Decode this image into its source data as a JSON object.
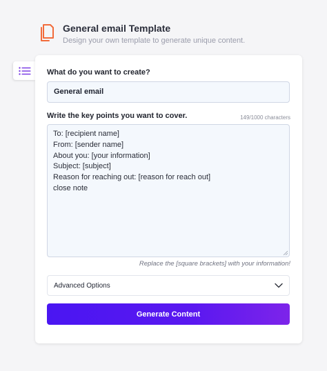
{
  "header": {
    "icon": "copy-document-icon",
    "title": "General email Template",
    "subtitle": "Design your own template to generate unique content."
  },
  "sidebar_toggle": {
    "icon": "list-menu-icon"
  },
  "form": {
    "create_label": "What do you want to create?",
    "create_value": "General email",
    "points_label": "Write the key points you want to cover.",
    "points_counter": "149/1000 characters",
    "points_lines": [
      "To: [recipient name]",
      "From: [sender name]",
      "About you: [your information]",
      "Subject: [subject]",
      "Reason for reaching out: [reason for reach out]",
      "close note"
    ],
    "hint": "Replace the [square brackets] with your information!",
    "advanced_label": "Advanced Options",
    "generate_label": "Generate Content"
  },
  "colors": {
    "accent": "#f26b3a",
    "button_start": "#4a16f2",
    "button_end": "#7d24ea",
    "menu_icon": "#7b3fe4"
  }
}
